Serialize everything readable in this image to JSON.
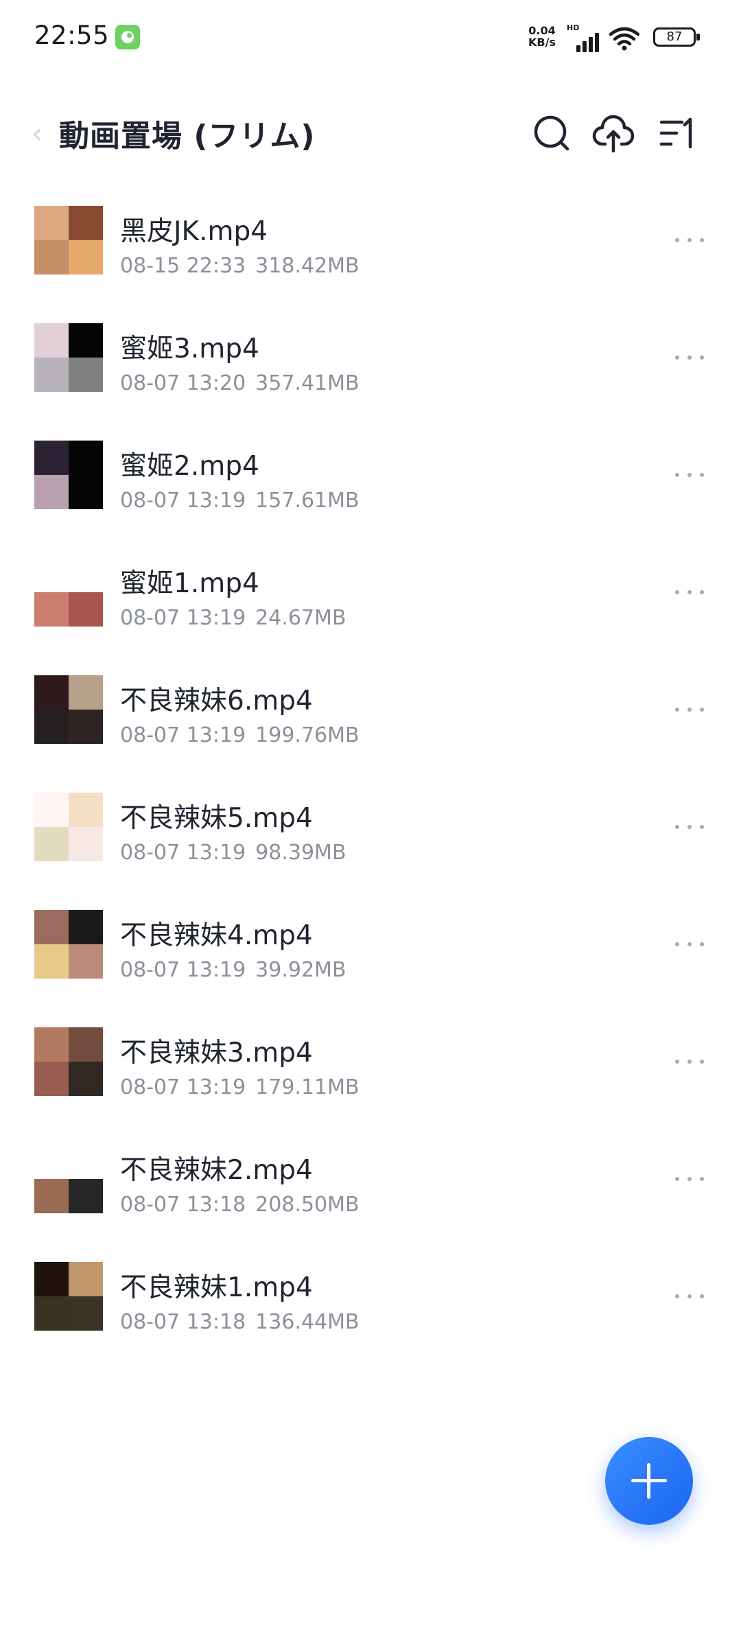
{
  "status_bar": {
    "time": "22:55",
    "net_speed_value": "0.04",
    "net_speed_unit": "KB/s",
    "signal_label": "HD",
    "battery": "87"
  },
  "header": {
    "title": "動画置場 (フリム)"
  },
  "files": [
    {
      "name": "黑皮JK.mp4",
      "date": "08-15 22:33",
      "size": "318.42MB",
      "thumb": [
        "#dba882",
        "#8a4a32",
        "#c58f68",
        "#e6aa6c"
      ]
    },
    {
      "name": "蜜姬3.mp4",
      "date": "08-07 13:20",
      "size": "357.41MB",
      "thumb": [
        "#e3d0d6",
        "#050505",
        "#b7b2b9",
        "#808080"
      ]
    },
    {
      "name": "蜜姬2.mp4",
      "date": "08-07 13:19",
      "size": "157.61MB",
      "thumb": [
        "#2b2334",
        "#050505",
        "#b9a1ad",
        "#050505"
      ]
    },
    {
      "name": "蜜姬1.mp4",
      "date": "08-07 13:19",
      "size": "24.67MB",
      "thumb": [
        "#ffffff",
        "#ffffff",
        "#c97e6e",
        "#a8554b"
      ]
    },
    {
      "name": "不良辣妹6.mp4",
      "date": "08-07 13:19",
      "size": "199.76MB",
      "thumb": [
        "#2e1a1c",
        "#b8a18a",
        "#242021",
        "#2f2424"
      ]
    },
    {
      "name": "不良辣妹5.mp4",
      "date": "08-07 13:19",
      "size": "98.39MB",
      "thumb": [
        "#fdf6f3",
        "#f4dfc4",
        "#e4dcc0",
        "#f7e8e6"
      ]
    },
    {
      "name": "不良辣妹4.mp4",
      "date": "08-07 13:19",
      "size": "39.92MB",
      "thumb": [
        "#9a6b5e",
        "#1a1a1a",
        "#e8c988",
        "#bc8a7a"
      ]
    },
    {
      "name": "不良辣妹3.mp4",
      "date": "08-07 13:19",
      "size": "179.11MB",
      "thumb": [
        "#b37a62",
        "#734d3e",
        "#995c50",
        "#2f2823"
      ]
    },
    {
      "name": "不良辣妹2.mp4",
      "date": "08-07 13:18",
      "size": "208.50MB",
      "thumb": [
        "#ffffff",
        "#ffffff",
        "#9b6b54",
        "#272727"
      ]
    },
    {
      "name": "不良辣妹1.mp4",
      "date": "08-07 13:18",
      "size": "136.44MB",
      "thumb": [
        "#1e120b",
        "#c0966a",
        "#3a3123",
        "#3a3225"
      ]
    }
  ],
  "colors": {
    "accent": "#2a77f8",
    "text_primary": "#1f2430",
    "text_secondary": "#8b909a"
  },
  "icons": {
    "search": "search-icon",
    "upload": "cloud-upload-icon",
    "sort": "sort-icon",
    "more": "more-icon",
    "add": "add-icon"
  }
}
